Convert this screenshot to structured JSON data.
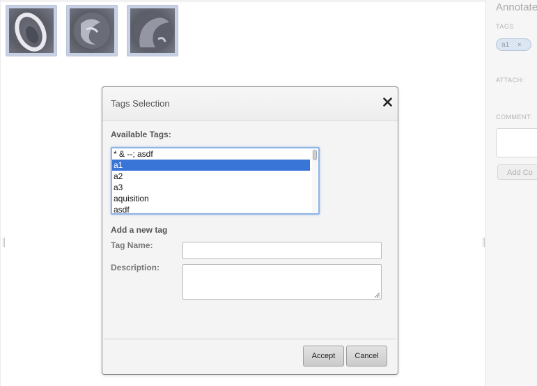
{
  "thumbnails": [
    {
      "icon": "thumbnail-image-1"
    },
    {
      "icon": "thumbnail-image-2"
    },
    {
      "icon": "thumbnail-image-3"
    }
  ],
  "right_panel": {
    "title": "Annotate",
    "tags_label": "TAGS",
    "tag_chip": "a1",
    "tag_remove": "×",
    "attach_label": "ATTACH:",
    "comment_label": "COMMENT:",
    "add_comment_button": "Add Co"
  },
  "dialog": {
    "title": "Tags Selection",
    "close_symbol": "✕",
    "available_tags_label": "Available Tags:",
    "available_tags": [
      "* & --; asdf",
      "a1",
      "a2",
      "a3",
      "aquisition",
      "asdf"
    ],
    "selected_tag": "a1",
    "add_new_tag_heading": "Add a new tag",
    "tag_name_label": "Tag Name:",
    "tag_name_value": "",
    "description_label": "Description:",
    "description_value": "",
    "accept_button": "Accept",
    "cancel_button": "Cancel"
  },
  "colors": {
    "selection": "#3875d7",
    "focus_ring": "#8db4e6",
    "tag_chip_bg": "#dce6f3"
  }
}
